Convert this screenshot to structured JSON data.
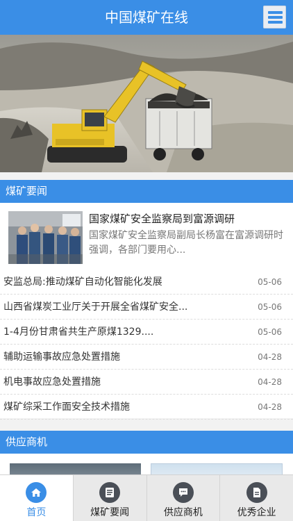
{
  "header": {
    "title": "中国煤矿在线",
    "menu_icon": "hamburger-menu-icon"
  },
  "colors": {
    "primary": "#3a8ee6",
    "tab_active": "#3a8ee6",
    "tab_icon": "#4a4f57"
  },
  "news_section": {
    "title": "煤矿要闻",
    "feature": {
      "title": "国家煤矿安全监察局到富源调研",
      "desc": "国家煤矿安全监察局副局长杨富在富源调研时强调，各部门要用心..."
    },
    "items": [
      {
        "title": "安监总局:推动煤矿自动化智能化发展",
        "date": "05-06"
      },
      {
        "title": "山西省煤炭工业厅关于开展全省煤矿安全...",
        "date": "05-06"
      },
      {
        "title": "1-4月份甘肃省共生产原煤1329....",
        "date": "05-06"
      },
      {
        "title": "辅助运输事故应急处置措施",
        "date": "04-28"
      },
      {
        "title": "机电事故应急处置措施",
        "date": "04-28"
      },
      {
        "title": "煤矿综采工作面安全技术措施",
        "date": "04-28"
      }
    ]
  },
  "supply_section": {
    "title": "供应商机"
  },
  "tabbar": {
    "tabs": [
      {
        "label": "首页",
        "icon": "home-icon"
      },
      {
        "label": "煤矿要闻",
        "icon": "news-icon"
      },
      {
        "label": "供应商机",
        "icon": "chat-icon"
      },
      {
        "label": "优秀企业",
        "icon": "document-icon"
      }
    ]
  }
}
